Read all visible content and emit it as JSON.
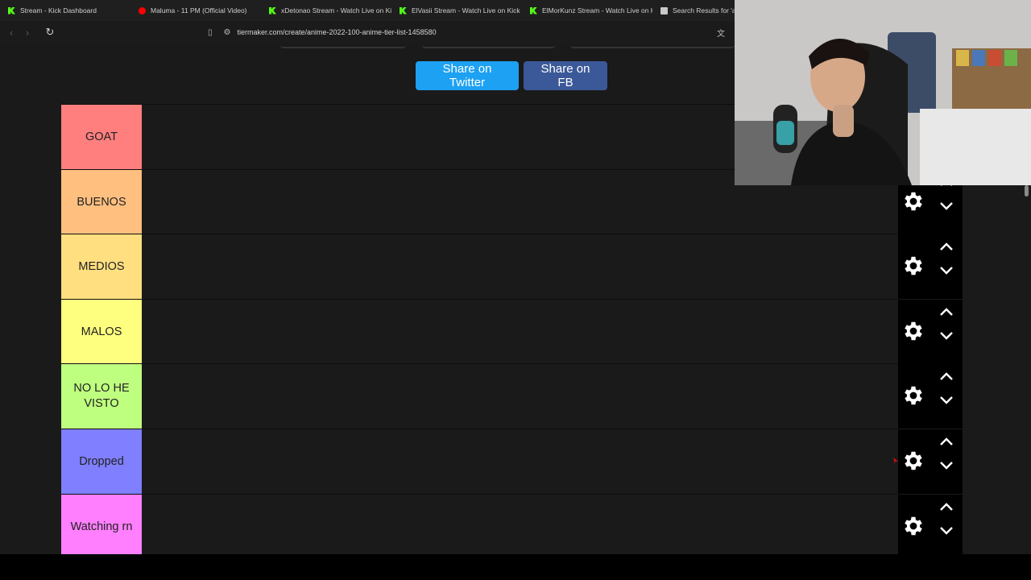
{
  "browser": {
    "tabs": [
      {
        "title": "Stream - Kick Dashboard",
        "icon": "kick-icon"
      },
      {
        "title": "Maluma - 11 PM (Official Video)",
        "icon": "youtube-icon"
      },
      {
        "title": "xDetonao Stream - Watch Live on Kick",
        "icon": "kick-icon"
      },
      {
        "title": "ElVasii Stream - Watch Live on Kick",
        "icon": "kick-icon"
      },
      {
        "title": "ElMorKunz Stream - Watch Live on Kick",
        "icon": "kick-icon"
      },
      {
        "title": "Search Results for 'an",
        "icon": "document-icon"
      }
    ],
    "url": "tiermaker.com/create/anime-2022-100-anime-tier-list-1458580"
  },
  "share": {
    "twitter_label": "Share on Twitter",
    "fb_label": "Share on FB",
    "twitter_color": "#1da1f2",
    "fb_color": "#3b5998"
  },
  "tiers": [
    {
      "label": "GOAT",
      "color": "#ff7f7f"
    },
    {
      "label": "BUENOS",
      "color": "#ffbf7f"
    },
    {
      "label": "MEDIOS",
      "color": "#ffdf7f"
    },
    {
      "label": "MALOS",
      "color": "#ffff7f"
    },
    {
      "label": "NO LO HE VISTO",
      "color": "#bfff7f"
    },
    {
      "label": "Dropped",
      "color": "#7f7fff"
    },
    {
      "label": "Watching rn",
      "color": "#ff7fff"
    }
  ],
  "icons": {
    "settings": "gear-icon",
    "move_up": "chevron-up-icon",
    "move_down": "chevron-down-icon"
  }
}
